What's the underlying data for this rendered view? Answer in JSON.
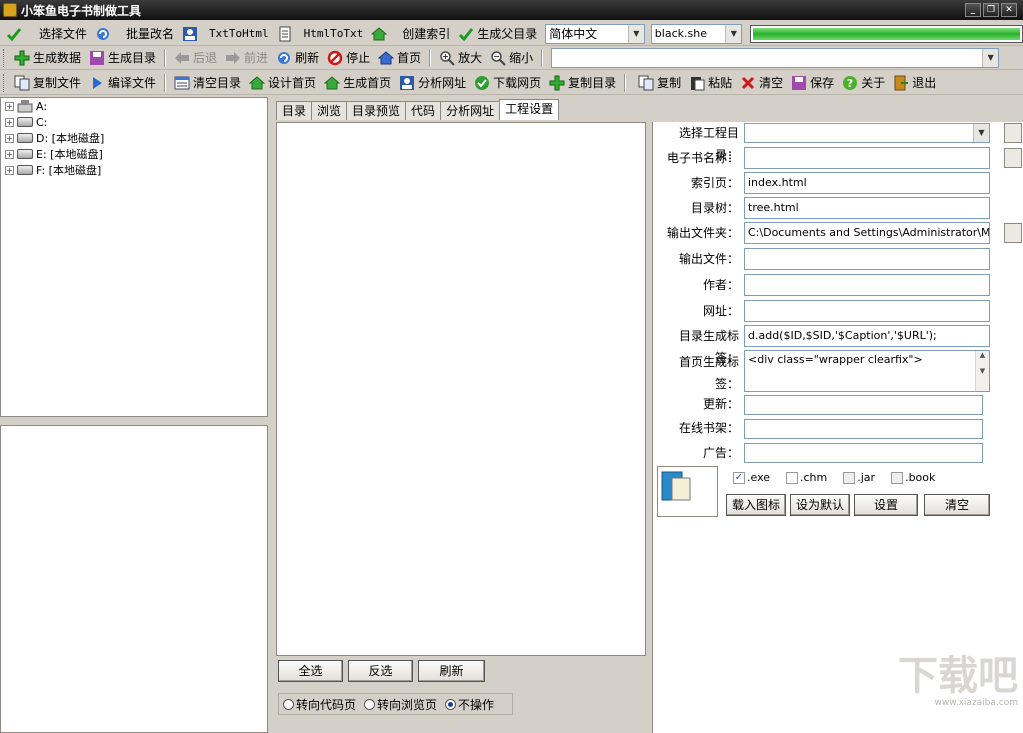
{
  "window": {
    "title": "小笨鱼电子书制做工具"
  },
  "toolbar1": {
    "select_file": "选择文件",
    "batch_rename": "批量改名",
    "txt_to_html": "TxtToHtml",
    "html_to_txt": "HtmlToTxt",
    "create_index": "创建索引",
    "gen_parent_dir": "生成父目录",
    "encoding_value": "简体中文",
    "skin_value": "black.she"
  },
  "toolbar2": {
    "gen_data": "生成数据",
    "gen_toc": "生成目录",
    "back": "后退",
    "forward": "前进",
    "refresh": "刷新",
    "stop": "停止",
    "home": "首页",
    "zoom_in": "放大",
    "zoom_out": "缩小"
  },
  "toolbar3": {
    "copy_file": "复制文件",
    "compile_file": "编译文件",
    "clear_toc": "清空目录",
    "design_home": "设计首页",
    "gen_home": "生成首页",
    "analyze_url": "分析网址",
    "download_page": "下载网页",
    "copy_toc": "复制目录",
    "copy": "复制",
    "paste": "粘贴",
    "clear": "清空",
    "save": "保存",
    "about": "关于",
    "exit": "退出"
  },
  "tree": {
    "drives": [
      {
        "label": "A:"
      },
      {
        "label": "C:"
      },
      {
        "label": "D: [本地磁盘]"
      },
      {
        "label": "E: [本地磁盘]"
      },
      {
        "label": "F: [本地磁盘]"
      }
    ]
  },
  "tabs": [
    "目录",
    "浏览",
    "目录预览",
    "代码",
    "分析网址",
    "工程设置"
  ],
  "middle": {
    "select_all": "全选",
    "invert": "反选",
    "refresh": "刷新",
    "radio_code": "转向代码页",
    "radio_browse": "转向浏览页",
    "radio_none": "不操作"
  },
  "settings": {
    "project_dir_label": "选择工程目录：",
    "project_dir_value": "",
    "ebook_name_label": "电子书名称：",
    "ebook_name_value": "",
    "index_page_label": "索引页：",
    "index_page_value": "index.html",
    "toc_tree_label": "目录树：",
    "toc_tree_value": "tree.html",
    "output_folder_label": "输出文件夹：",
    "output_folder_value": "C:\\Documents and Settings\\Administrator\\My Docu",
    "output_file_label": "输出文件：",
    "output_file_value": "",
    "author_label": "作者：",
    "author_value": "",
    "website_label": "网址：",
    "website_value": "",
    "toc_tag_label": "目录生成标签：",
    "toc_tag_value": "d.add($ID,$SID,'$Caption','$URL');",
    "home_tag_label": "首页生成标签：",
    "home_tag_value": "<div class=\"wrapper clearfix\">",
    "update_label": "更新：",
    "update_value": "",
    "bookshelf_label": "在线书架：",
    "bookshelf_value": "",
    "ad_label": "广告：",
    "ad_value": "",
    "formats": [
      {
        "label": ".exe",
        "checked": true
      },
      {
        "label": ".chm",
        "checked": false
      },
      {
        "label": ".jar",
        "checked": false
      },
      {
        "label": ".book",
        "checked": false
      }
    ],
    "load_icon": "载入图标",
    "set_default": "设为默认",
    "settings_btn": "设置",
    "clear_btn": "清空"
  },
  "watermark": {
    "text": "下载吧",
    "url": "www.xiazaiba.com"
  }
}
